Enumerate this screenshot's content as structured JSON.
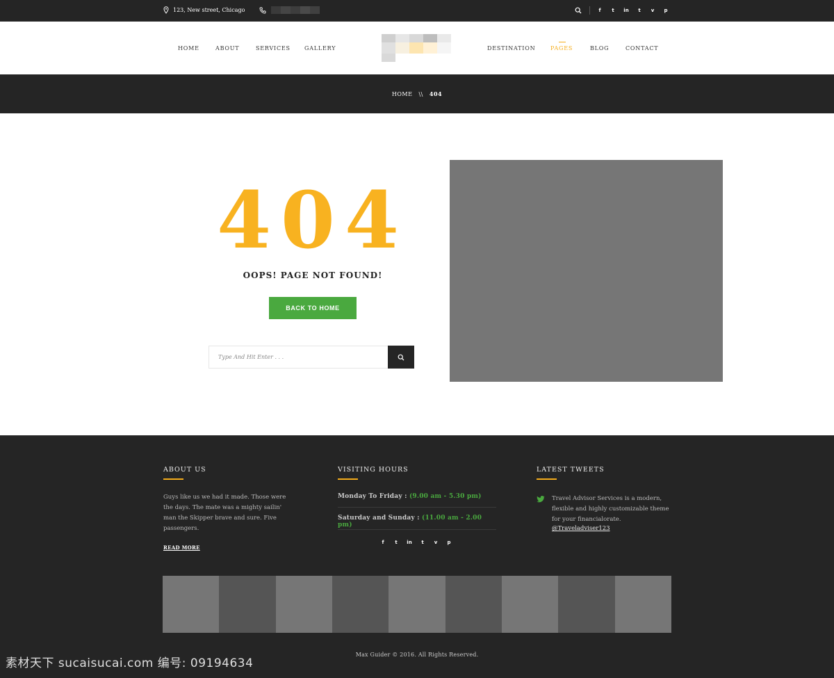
{
  "topbar": {
    "address": "123, New street, Chicago",
    "social": [
      "f",
      "t",
      "in",
      "t",
      "v",
      "p"
    ]
  },
  "nav": {
    "left": [
      "HOME",
      "ABOUT",
      "SERVICES",
      "GALLERY"
    ],
    "right": [
      "DESTINATION",
      "PAGES",
      "BLOG",
      "CONTACT"
    ],
    "active": "PAGES"
  },
  "breadcrumb": {
    "home": "HOME",
    "separator": "\\\\",
    "current": "404"
  },
  "error": {
    "code": "404",
    "message": "OOPS! PAGE NOT FOUND!",
    "button": "BACK TO HOME",
    "search_placeholder": "Type And Hit Enter . . ."
  },
  "footer": {
    "about": {
      "heading": "ABOUT US",
      "text": "Guys like us we had it made. Those were the days. The mate was a mighty sailin' man the Skipper brave and sure. Five passengers.",
      "read_more": "READ MORE"
    },
    "hours": {
      "heading": "VISITING HOURS",
      "rows": [
        {
          "label": "Monday To Friday :",
          "value": "(9.00 am - 5.30 pm)"
        },
        {
          "label": "Saturday and Sunday :",
          "value": "(11.00 am - 2.00 pm)"
        }
      ],
      "social": [
        "f",
        "t",
        "in",
        "t",
        "v",
        "p"
      ]
    },
    "tweets": {
      "heading": "LATEST TWEETS",
      "text": "Travel Advisor Services is a modern, flexible and highly customizable theme for your financialorate.",
      "handle": "@Traveladviser123"
    },
    "copyright": "Max Guider © 2016.  All Rights Reserved."
  },
  "watermark": "素材天下 sucaisucai.com  编号: 09194634",
  "colors": {
    "accent": "#f8b220",
    "green": "#4aa93f",
    "dark": "#252525"
  }
}
